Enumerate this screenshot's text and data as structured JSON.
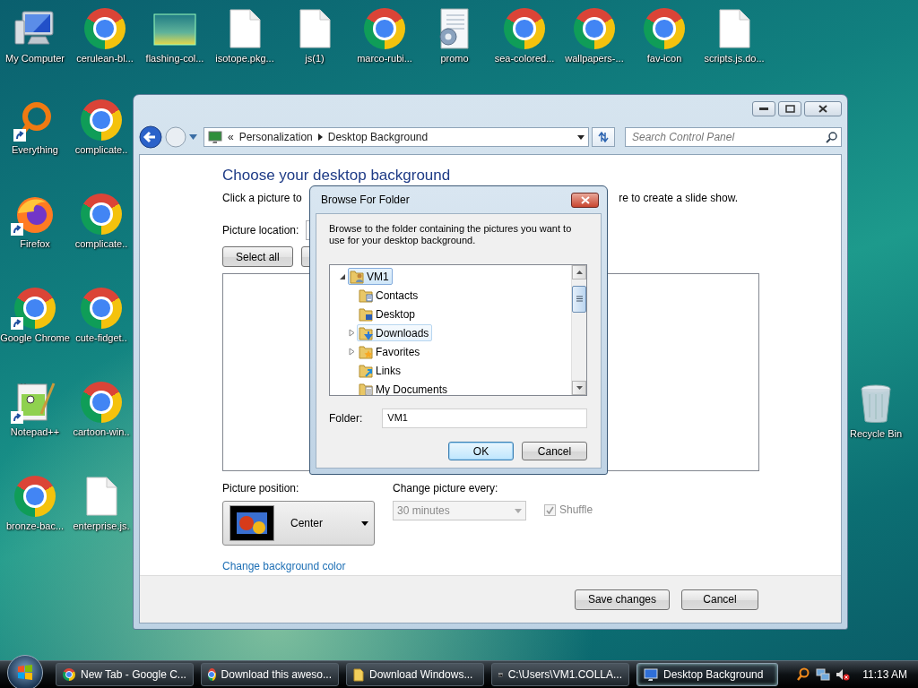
{
  "desktop": {
    "top_row": [
      {
        "label": "My Computer",
        "kind": "computer"
      },
      {
        "label": "cerulean-bl...",
        "kind": "chrome"
      },
      {
        "label": "flashing-col...",
        "kind": "image"
      },
      {
        "label": "isotope.pkg...",
        "kind": "file"
      },
      {
        "label": "js(1)",
        "kind": "file"
      },
      {
        "label": "marco-rubi...",
        "kind": "chrome"
      },
      {
        "label": "promo",
        "kind": "config"
      },
      {
        "label": "sea-colored...",
        "kind": "chrome"
      },
      {
        "label": "wallpapers-...",
        "kind": "chrome"
      },
      {
        "label": "fav-icon",
        "kind": "chrome"
      },
      {
        "label": "scripts.js.do...",
        "kind": "file"
      }
    ],
    "left_grid": [
      {
        "label": "Everything",
        "kind": "ring",
        "shortcut": true
      },
      {
        "label": "complicate..",
        "kind": "chrome"
      },
      {
        "label": "Firefox",
        "kind": "firefox",
        "shortcut": true
      },
      {
        "label": "complicate..",
        "kind": "chrome"
      },
      {
        "label": "Google Chrome",
        "kind": "chrome",
        "shortcut": true
      },
      {
        "label": "cute-fidget..",
        "kind": "chrome"
      },
      {
        "label": "Notepad++",
        "kind": "notepad",
        "shortcut": true
      },
      {
        "label": "cartoon-win..",
        "kind": "chrome"
      },
      {
        "label": "bronze-bac...",
        "kind": "chrome"
      },
      {
        "label": "enterprise.js.",
        "kind": "file"
      }
    ],
    "right": [
      {
        "label": "Recycle Bin",
        "kind": "recycle"
      }
    ]
  },
  "window": {
    "address": {
      "chevron": "«",
      "crumbs": [
        "Personalization",
        "Desktop Background"
      ]
    },
    "search": {
      "placeholder": "Search Control Panel"
    },
    "heading": "Choose your desktop background",
    "instruction_left": "Click a picture to",
    "instruction_right": "re to create a slide show.",
    "picture_location_label": "Picture location:",
    "buttons": [
      "Select all"
    ],
    "picture_position": {
      "label": "Picture position:",
      "value": "Center"
    },
    "change_every": {
      "label": "Change picture every:",
      "value": "30 minutes",
      "disabled": true
    },
    "shuffle": {
      "label": "Shuffle",
      "checked": true,
      "disabled": true
    },
    "link": "Change background color",
    "footer_buttons": [
      "Save changes",
      "Cancel"
    ]
  },
  "dialog": {
    "title": "Browse For Folder",
    "description": "Browse to the folder containing the pictures you want to use for your desktop background.",
    "tree": [
      {
        "label": "VM1",
        "kind": "user",
        "has_children": true,
        "expanded": true,
        "selected": true,
        "hovered": false,
        "children": [
          {
            "label": "Contacts",
            "kind": "contacts",
            "selected": false,
            "hovered": false
          },
          {
            "label": "Desktop",
            "kind": "desktop",
            "selected": false,
            "hovered": false
          },
          {
            "label": "Downloads",
            "kind": "downloads",
            "has_children": true,
            "expanded": false,
            "selected": false,
            "hovered": true
          },
          {
            "label": "Favorites",
            "kind": "favorites",
            "has_children": true,
            "expanded": false,
            "selected": false,
            "hovered": false
          },
          {
            "label": "Links",
            "kind": "links",
            "selected": false,
            "hovered": false
          },
          {
            "label": "My Documents",
            "kind": "documents",
            "selected": false,
            "hovered": false
          }
        ]
      }
    ],
    "folder_label": "Folder:",
    "folder_value": "VM1",
    "buttons": [
      {
        "label": "OK",
        "default": true
      },
      {
        "label": "Cancel",
        "default": false
      }
    ]
  },
  "taskbar": {
    "tasks": [
      {
        "label": "New Tab - Google C...",
        "kind": "chrome",
        "selected": false
      },
      {
        "label": "Download this aweso...",
        "kind": "chrome",
        "selected": false
      },
      {
        "label": "Download Windows...",
        "kind": "folder",
        "selected": false
      },
      {
        "label": "C:\\Users\\VM1.COLLA...",
        "kind": "console",
        "selected": false
      },
      {
        "label": "Desktop Background",
        "kind": "display",
        "selected": true
      }
    ],
    "clock": "11:13 AM"
  }
}
